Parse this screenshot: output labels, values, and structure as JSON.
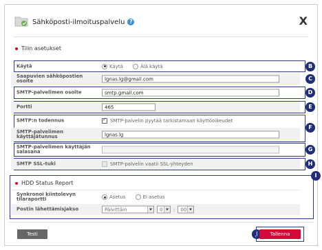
{
  "dialog": {
    "title": "Sähköposti-ilmoituspalvelu",
    "help_icon": "question-icon",
    "app_icon": "folder-check-icon",
    "close_label": "X"
  },
  "account": {
    "heading": "Tilin asetukset",
    "use": {
      "label": "Käytä",
      "opt_on": "Käytä",
      "opt_off": "Älä käytä"
    },
    "email": {
      "label": "Saapuvien sähköpostien osoite",
      "value": "lgnas.lg@gmail.com"
    },
    "smtp_address": {
      "label": "SMTP-palvelimen osoite",
      "value": "smtp.gmail.com"
    },
    "port": {
      "label": "Portti",
      "value": "465"
    },
    "smtp_auth": {
      "label": "SMTP:n todennus",
      "check_text": "SMTP-palvelin pyytää tarkistamaan käyttöoikeudet"
    },
    "smtp_user": {
      "label": "SMTP-palvelimen käyttäjätunnus",
      "value": "lgnas.lg"
    },
    "smtp_password": {
      "label": "SMTP-palvelimen käyttäjän salasana",
      "value": ""
    },
    "ssl": {
      "label": "SMTP SSL-tuki",
      "check_text": "SMTP-palvelin vaatii SSL-yhteyden"
    }
  },
  "hdd": {
    "heading": "HDD Status Report",
    "sync": {
      "label": "Synkronoi kiintolevyn tilaraportti",
      "opt_on": "Asetus",
      "opt_off": "Ei asetus"
    },
    "period": {
      "label": "Postin lähettämisjakso",
      "frequency": "Päivittäin",
      "hour": "0",
      "sep": ":",
      "minute": "00"
    }
  },
  "markers": [
    "B",
    "C",
    "D",
    "E",
    "F",
    "G",
    "H",
    "I",
    "J"
  ],
  "buttons": {
    "test": "Testi",
    "save": "Tallenna"
  },
  "colors": {
    "accent": "#d6083b",
    "marker": "#1f2d7a",
    "outline": "#2e3a8c"
  }
}
